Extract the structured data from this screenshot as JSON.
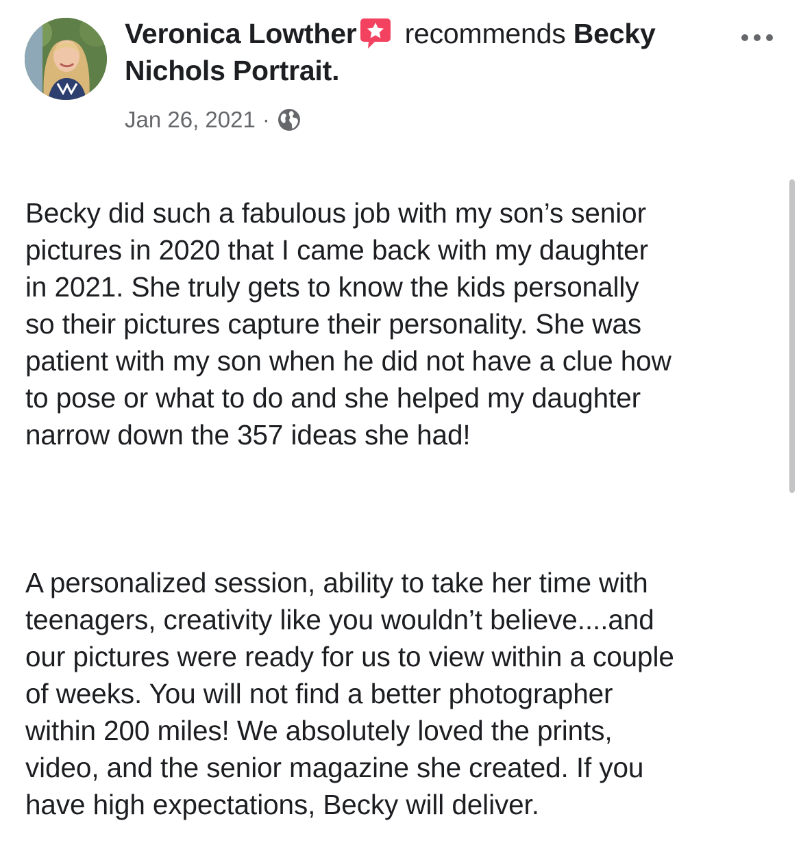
{
  "post": {
    "author": "Veronica Lowther",
    "action": "recommends",
    "page_line1": "Becky",
    "page_line2": "Nichols Portrait",
    "page_end": ".",
    "date": "Jan 26, 2021",
    "separator": "·",
    "privacy_icon": "globe-icon",
    "recommend_icon": "recommendation-badge-icon",
    "more_icon": "more-options-icon",
    "paragraphs": [
      "Becky did such a fabulous job with my son’s senior\npictures in 2020 that I came back with my daughter\nin 2021.  She truly gets to know the kids personally\nso their pictures capture their personality.  She was\npatient with my son when he did not have a clue how\nto pose or what to do and she helped my daughter\nnarrow down the 357 ideas she had!",
      "A personalized session, ability to take her time with\nteenagers, creativity like you wouldn’t believe....and\nour pictures were ready for us to view within a couple\nof weeks.  You will not find a better photographer\nwithin 200 miles!  We absolutely loved the prints,\nvideo, and the senior magazine she created.  If you\nhave high expectations, Becky will deliver."
    ]
  },
  "colors": {
    "text": "#1c1e21",
    "meta": "#65676b",
    "badge": "#f3425f",
    "scrollbar": "#c4c4c6"
  }
}
